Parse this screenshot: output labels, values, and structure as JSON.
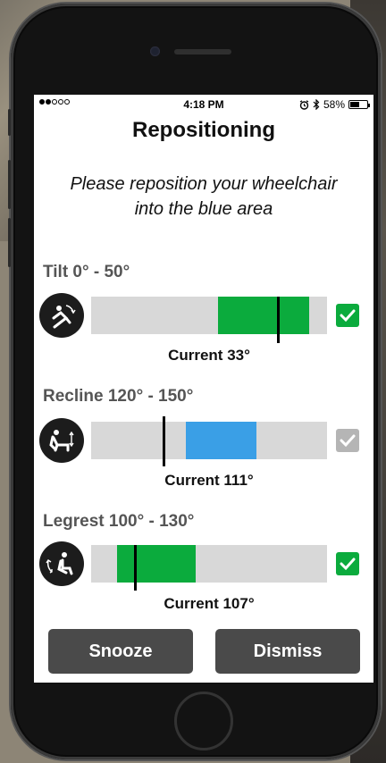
{
  "status_bar": {
    "time": "4:18 PM",
    "battery": "58%",
    "battery_level": 0.58,
    "signal_filled": 2,
    "signal_total": 5
  },
  "screen": {
    "title": "Repositioning",
    "instruction_line1": "Please reposition your wheelchair",
    "instruction_line2": "into the blue area"
  },
  "colors": {
    "in_range": "#0bab3d",
    "target": "#3a9fe6",
    "track": "#d8d8d8",
    "check_on": "#0bab3d",
    "check_off": "#b5b5b5",
    "button": "#4a4a4a"
  },
  "sections": [
    {
      "name": "Tilt",
      "label": "Tilt  0° - 50°",
      "icon": "tilt-chair-icon",
      "range_min": 0,
      "range_max": 50,
      "current": 33,
      "current_label": "Current 33°",
      "scale_min": -70,
      "scale_max": 60,
      "zone_state": "in-range",
      "checked": true
    },
    {
      "name": "Recline",
      "label": "Recline  120° - 150°",
      "icon": "recline-chair-icon",
      "range_min": 120,
      "range_max": 150,
      "current": 111,
      "current_label": "Current 111°",
      "scale_min": 80,
      "scale_max": 180,
      "zone_state": "target",
      "checked": false
    },
    {
      "name": "Legrest",
      "label": "Legrest  100° - 130°",
      "icon": "legrest-chair-icon",
      "range_min": 100,
      "range_max": 130,
      "current": 107,
      "current_label": "Current 107°",
      "scale_min": 90,
      "scale_max": 180,
      "zone_state": "in-range",
      "checked": true
    }
  ],
  "buttons": {
    "snooze": "Snooze",
    "dismiss": "Dismiss"
  }
}
